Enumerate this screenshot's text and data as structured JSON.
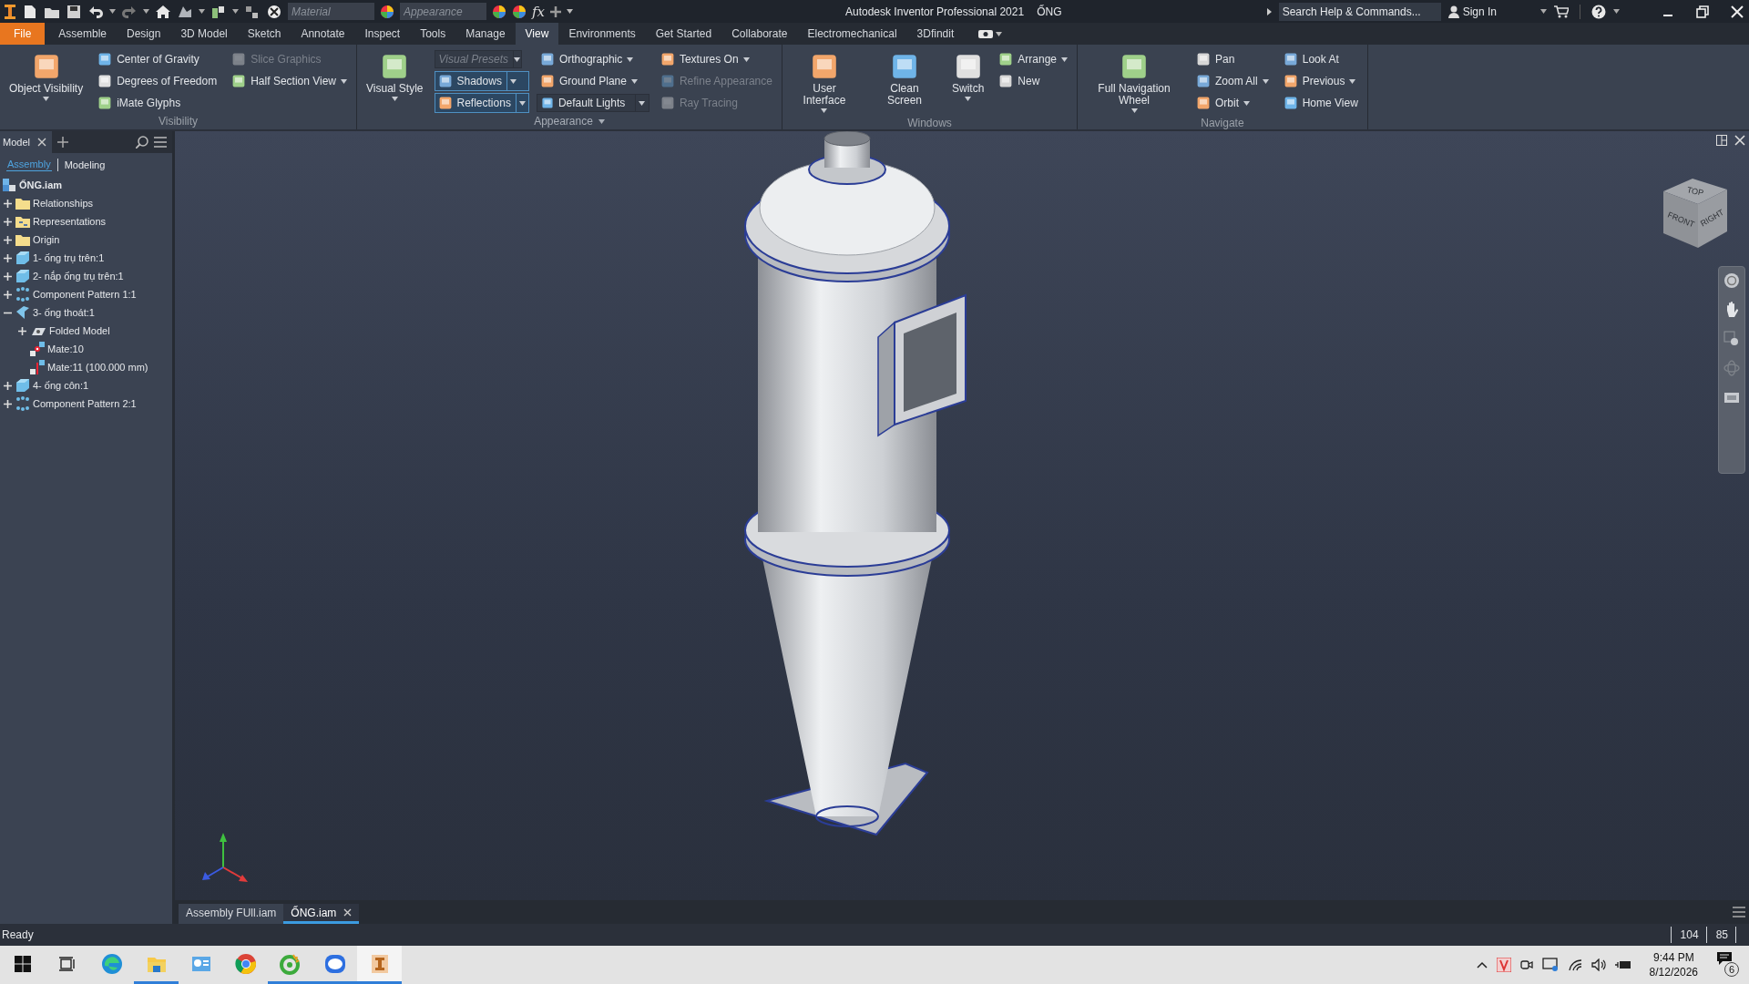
{
  "title_bar": {
    "quick_access": {
      "material_placeholder": "Material",
      "appearance_placeholder": "Appearance",
      "formula": "fx"
    },
    "app_title": "Autodesk Inventor Professional 2021",
    "document_title": "ỐNG",
    "search": {
      "placeholder": "Search Help & Commands..."
    },
    "sign_in": "Sign In"
  },
  "ribbon_tabs": [
    {
      "label": "File",
      "kind": "file",
      "selected": false
    },
    {
      "label": "Assemble",
      "kind": "tab",
      "selected": false
    },
    {
      "label": "Design",
      "kind": "tab",
      "selected": false
    },
    {
      "label": "3D Model",
      "kind": "tab",
      "selected": false
    },
    {
      "label": "Sketch",
      "kind": "tab",
      "selected": false
    },
    {
      "label": "Annotate",
      "kind": "tab",
      "selected": false
    },
    {
      "label": "Inspect",
      "kind": "tab",
      "selected": false
    },
    {
      "label": "Tools",
      "kind": "tab",
      "selected": false
    },
    {
      "label": "Manage",
      "kind": "tab",
      "selected": false
    },
    {
      "label": "View",
      "kind": "tab",
      "selected": true
    },
    {
      "label": "Environments",
      "kind": "tab",
      "selected": false
    },
    {
      "label": "Get Started",
      "kind": "tab",
      "selected": false
    },
    {
      "label": "Collaborate",
      "kind": "tab",
      "selected": false
    },
    {
      "label": "Electromechanical",
      "kind": "tab",
      "selected": false
    },
    {
      "label": "3Dfindit",
      "kind": "tab",
      "selected": false
    }
  ],
  "ribbon_panels": [
    {
      "title": "Visibility",
      "has_menu": false,
      "columns": [
        [
          {
            "label": "Object Visibility",
            "kind": "big",
            "disabled": false,
            "dropdown": true,
            "on": false
          }
        ],
        [
          {
            "label": "Center of Gravity",
            "kind": "small",
            "disabled": false,
            "dropdown": false,
            "on": false
          },
          {
            "label": "Degrees of Freedom",
            "kind": "small",
            "disabled": false,
            "dropdown": false,
            "on": false
          },
          {
            "label": "iMate Glyphs",
            "kind": "small",
            "disabled": false,
            "dropdown": false,
            "on": false
          }
        ],
        [
          {
            "label": "Slice Graphics",
            "kind": "small",
            "disabled": true,
            "dropdown": false,
            "on": false
          },
          {
            "label": "Half Section View",
            "kind": "small",
            "disabled": false,
            "dropdown": true,
            "on": false
          }
        ]
      ]
    },
    {
      "title": "Appearance",
      "has_menu": true,
      "columns": [
        [
          {
            "label": "Visual Style",
            "kind": "big",
            "disabled": false,
            "dropdown": true,
            "on": false
          }
        ],
        [
          {
            "label": "Visual Presets",
            "kind": "combo",
            "disabled": true,
            "dropdown": true,
            "on": false
          },
          {
            "label": "Shadows",
            "kind": "small",
            "disabled": false,
            "dropdown": true,
            "on": true
          },
          {
            "label": "Reflections",
            "kind": "small",
            "disabled": false,
            "dropdown": true,
            "on": true
          }
        ],
        [
          {
            "label": "Orthographic",
            "kind": "small",
            "disabled": false,
            "dropdown": true,
            "on": false
          },
          {
            "label": "Ground Plane",
            "kind": "small",
            "disabled": false,
            "dropdown": true,
            "on": false
          },
          {
            "label": "Default Lights",
            "kind": "combo",
            "disabled": false,
            "dropdown": true,
            "on": false
          }
        ],
        [
          {
            "label": "Textures On",
            "kind": "small",
            "disabled": false,
            "dropdown": true,
            "on": false
          },
          {
            "label": "Refine Appearance",
            "kind": "small",
            "disabled": true,
            "dropdown": false,
            "on": false
          },
          {
            "label": "Ray Tracing",
            "kind": "small",
            "disabled": true,
            "dropdown": false,
            "on": false
          }
        ]
      ]
    },
    {
      "title": "Windows",
      "has_menu": false,
      "columns": [
        [
          {
            "label": "User Interface",
            "kind": "big",
            "disabled": false,
            "dropdown": true,
            "on": false
          }
        ],
        [
          {
            "label": "Clean Screen",
            "kind": "big",
            "disabled": false,
            "dropdown": false,
            "on": false
          }
        ],
        [
          {
            "label": "Switch",
            "kind": "big",
            "disabled": false,
            "dropdown": true,
            "on": false
          }
        ],
        [
          {
            "label": "Arrange",
            "kind": "small",
            "disabled": false,
            "dropdown": true,
            "on": false
          },
          {
            "label": "New",
            "kind": "small",
            "disabled": false,
            "dropdown": false,
            "on": false
          }
        ]
      ]
    },
    {
      "title": "Navigate",
      "has_menu": false,
      "columns": [
        [
          {
            "label": "Full Navigation Wheel",
            "kind": "big",
            "disabled": false,
            "dropdown": true,
            "on": false
          }
        ],
        [
          {
            "label": "Pan",
            "kind": "small",
            "disabled": false,
            "dropdown": false,
            "on": false
          },
          {
            "label": "Zoom All",
            "kind": "small",
            "disabled": false,
            "dropdown": true,
            "on": false
          },
          {
            "label": "Orbit",
            "kind": "small",
            "disabled": false,
            "dropdown": true,
            "on": false
          }
        ],
        [
          {
            "label": "Look At",
            "kind": "small",
            "disabled": false,
            "dropdown": false,
            "on": false
          },
          {
            "label": "Previous",
            "kind": "small",
            "disabled": false,
            "dropdown": true,
            "on": false
          },
          {
            "label": "Home View",
            "kind": "small",
            "disabled": false,
            "dropdown": false,
            "on": false
          }
        ]
      ]
    }
  ],
  "browser": {
    "tabs": [
      {
        "label": "Model",
        "selected": true
      }
    ],
    "views": [
      {
        "label": "Assembly",
        "selected": true
      },
      {
        "label": "Modeling",
        "selected": false
      }
    ],
    "tree": {
      "label": "ỐNG.iam",
      "kind": "assembly",
      "children": [
        {
          "label": "Relationships",
          "kind": "folder",
          "expanded": false
        },
        {
          "label": "Representations",
          "kind": "representations",
          "expanded": false
        },
        {
          "label": "Origin",
          "kind": "folder",
          "expanded": false
        },
        {
          "label": "1- ống trụ trên:1",
          "kind": "part",
          "expanded": false
        },
        {
          "label": "2- nắp ống trụ trên:1",
          "kind": "part",
          "expanded": false
        },
        {
          "label": "Component Pattern 1:1",
          "kind": "pattern",
          "expanded": false
        },
        {
          "label": "3- ống thoát:1",
          "kind": "sheet",
          "expanded": true,
          "children": [
            {
              "label": "Folded Model",
              "kind": "folded",
              "expanded": false
            },
            {
              "label": "Mate:10",
              "kind": "mate"
            },
            {
              "label": "Mate:11 (100.000 mm)",
              "kind": "mate-offset"
            }
          ]
        },
        {
          "label": "4- ống côn:1",
          "kind": "part",
          "expanded": false
        },
        {
          "label": "Component Pattern 2:1",
          "kind": "pattern",
          "expanded": false
        }
      ]
    }
  },
  "view_cube": {
    "faces": [
      "TOP",
      "FRONT",
      "RIGHT"
    ]
  },
  "documents": [
    {
      "label": "Assembly FUll.iam",
      "selected": false
    },
    {
      "label": "ỐNG.iam",
      "selected": true
    }
  ],
  "status_bar": {
    "message": "Ready",
    "fields": [
      "104",
      "85"
    ]
  },
  "taskbar": {
    "apps": [
      {
        "running": false,
        "active": false
      },
      {
        "running": true,
        "active": false
      },
      {
        "running": false,
        "active": false
      },
      {
        "running": false,
        "active": false
      },
      {
        "running": true,
        "active": false
      },
      {
        "running": true,
        "active": false
      },
      {
        "running": true,
        "active": true
      }
    ],
    "time": "9:44 PM",
    "date": "8/12/2026",
    "notifications": "6"
  }
}
